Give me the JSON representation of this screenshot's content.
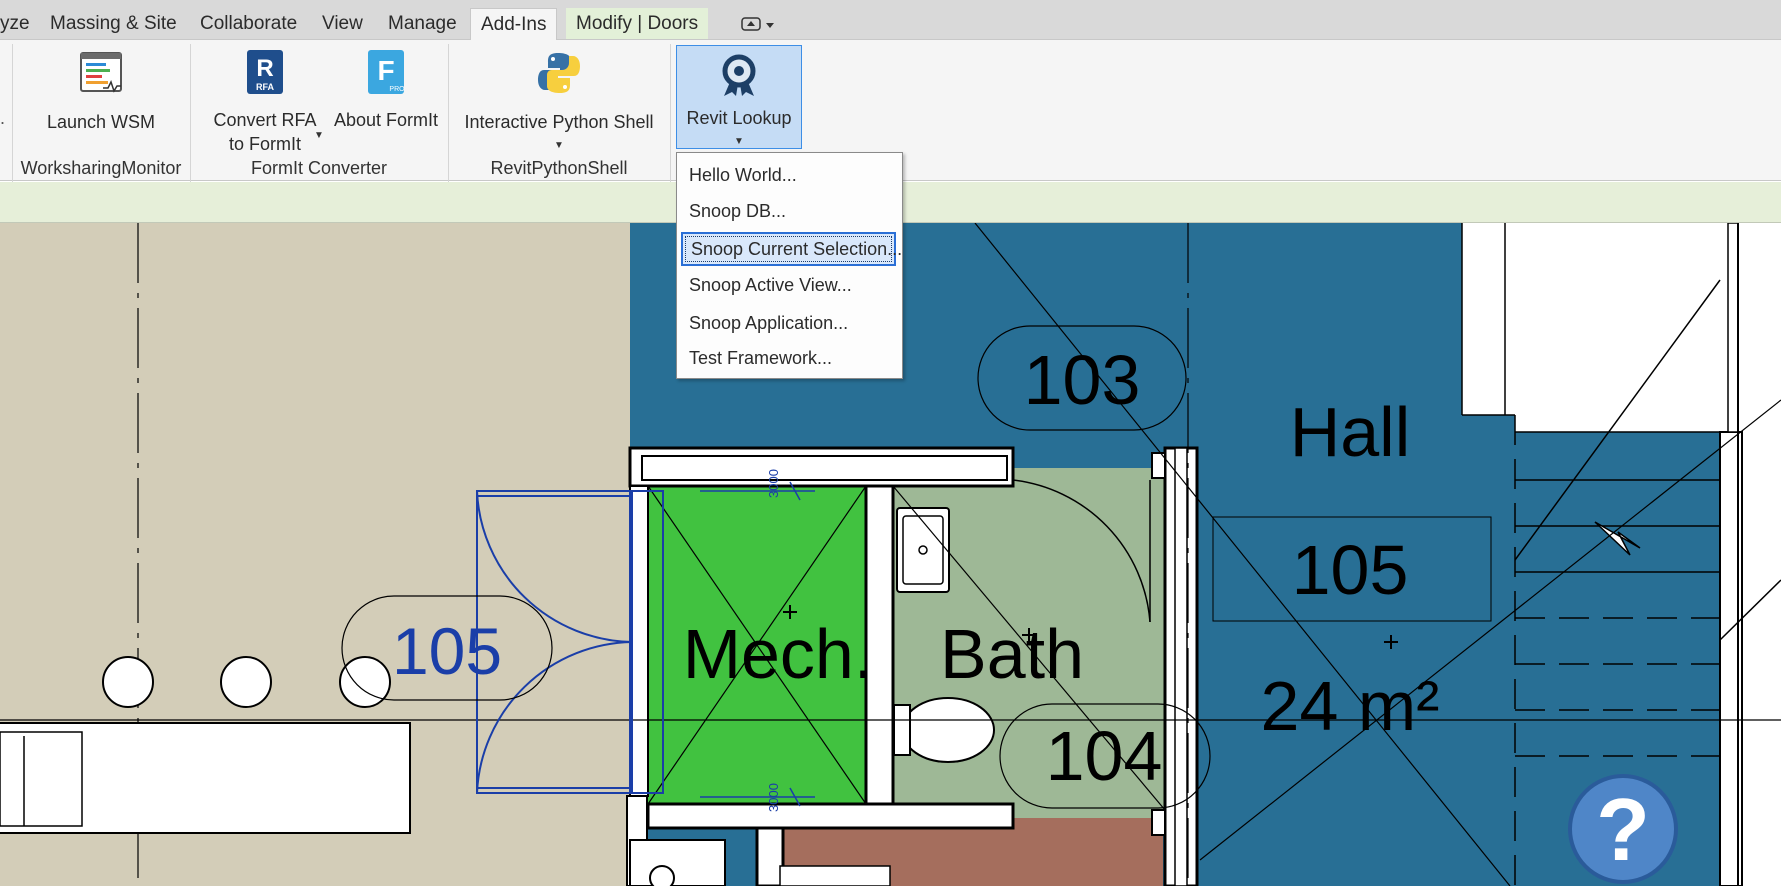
{
  "tabs": [
    {
      "label": "yze"
    },
    {
      "label": "Massing & Site"
    },
    {
      "label": "Collaborate"
    },
    {
      "label": "View"
    },
    {
      "label": "Manage"
    },
    {
      "label": "Add-Ins"
    },
    {
      "label": "Modify | Doors"
    }
  ],
  "active_tab": "Add-Ins",
  "ribbon": {
    "launch_wsm": "Launch WSM",
    "convert_rfa_1": "Convert RFA",
    "convert_rfa_2": "to FormIt",
    "about_formit": "About FormIt",
    "python_shell": "Interactive Python Shell",
    "revit_lookup": "Revit Lookup",
    "panels": {
      "worksharing": "WorksharingMonitor",
      "formit": "FormIt Converter",
      "python": "RevitPythonShell"
    },
    "rfa_badge": "RFA",
    "formit_letter": "F",
    "pro_badge": "PRO"
  },
  "dropdown": {
    "items": [
      "Hello World...",
      "Snoop DB...",
      "Snoop Current Selection...",
      "Snoop Active View...",
      "Snoop Application...",
      "Test Framework..."
    ],
    "selected": "Snoop Current Selection..."
  },
  "plan": {
    "tags": {
      "door_tag": "105",
      "room_103": "103",
      "room_104": "104",
      "room_105": "105",
      "hall": "Hall",
      "area": "24 m²",
      "mech": "Mech.",
      "bath": "Bath",
      "dim_top": "3000",
      "dim_bottom": "3000"
    },
    "colors": {
      "floor_beige": "#d3cdb8",
      "hall_blue": "#286f95",
      "mech_green": "#41c240",
      "bath_green": "#9eb896",
      "brown": "#a56e5d",
      "door_blue": "#1a3ea8"
    }
  },
  "help": {
    "label": "?"
  }
}
